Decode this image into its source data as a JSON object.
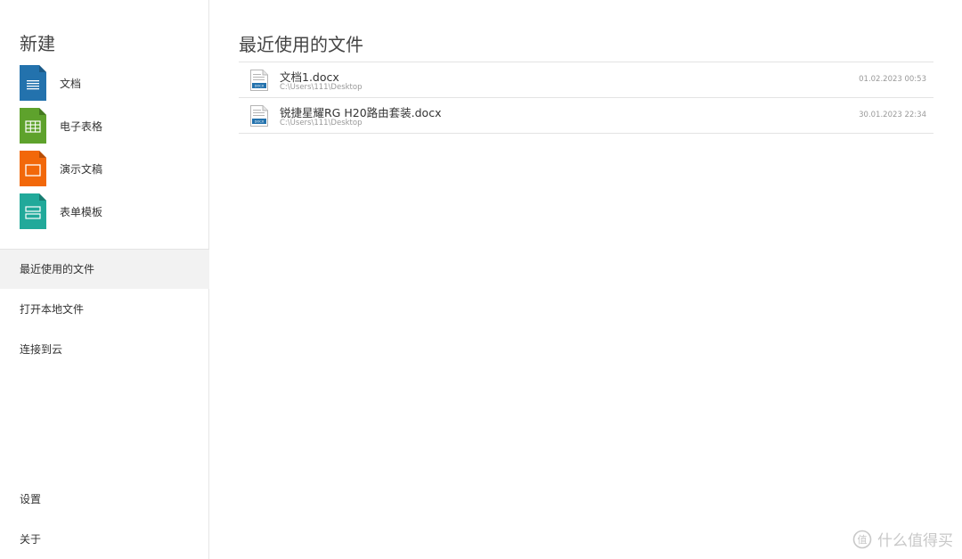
{
  "sidebar": {
    "new_title": "新建",
    "new_items": [
      {
        "label": "文档",
        "icon": "document-icon",
        "color": "#2372ad"
      },
      {
        "label": "电子表格",
        "icon": "spreadsheet-icon",
        "color": "#5ea22c"
      },
      {
        "label": "演示文稿",
        "icon": "presentation-icon",
        "color": "#f2680a"
      },
      {
        "label": "表单模板",
        "icon": "form-template-icon",
        "color": "#21a99a"
      }
    ],
    "nav": [
      {
        "label": "最近使用的文件",
        "active": true
      },
      {
        "label": "打开本地文件",
        "active": false
      },
      {
        "label": "连接到云",
        "active": false
      }
    ],
    "bottom_nav": [
      {
        "label": "设置"
      },
      {
        "label": "关于"
      }
    ]
  },
  "main": {
    "title": "最近使用的文件",
    "files": [
      {
        "name": "文档1.docx",
        "path": "C:\\Users\\111\\Desktop",
        "date": "01.02.2023 00:53",
        "icon": "docx-file-icon"
      },
      {
        "name": "锐捷星耀RG H20路由套装.docx",
        "path": "C:\\Users\\111\\Desktop",
        "date": "30.01.2023 22:34",
        "icon": "docx-file-icon"
      }
    ]
  },
  "watermark": {
    "text": "什么值得买",
    "icon": "zhidemai-logo"
  },
  "colors": {
    "active_nav_bg": "#f2f2f2",
    "divider": "#e3e3e3"
  }
}
